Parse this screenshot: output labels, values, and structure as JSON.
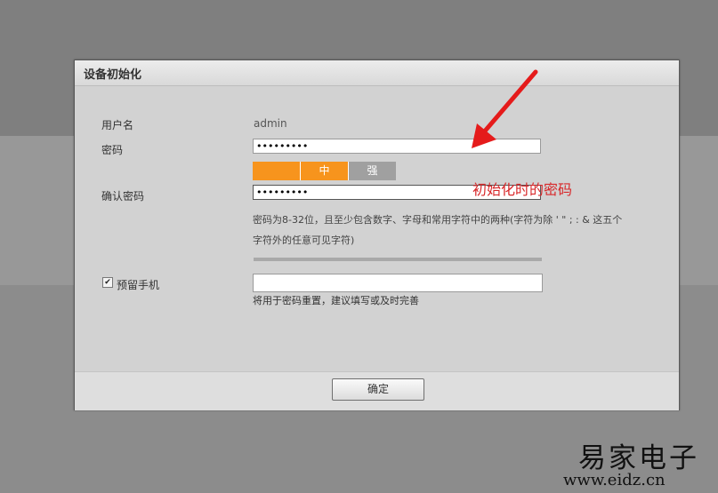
{
  "dialog": {
    "title": "设备初始化",
    "username_label": "用户名",
    "username_value": "admin",
    "password_label": "密码",
    "password_value": "•••••••••",
    "strength": {
      "medium_label": "中",
      "strong_label": "强",
      "active_color": "#f7941d",
      "inactive_color": "#a0a0a0"
    },
    "confirm_label": "确认密码",
    "confirm_value": "•••••••••",
    "hint_line1": "密码为8-32位，且至少包含数字、字母和常用字符中的两种(字符为除 ' \" ; : & 这五个",
    "hint_line2": "字符外的任意可见字符)",
    "phone_checkbox_label": "预留手机",
    "phone_checkbox_checked": true,
    "phone_value": "",
    "phone_hint": "将用于密码重置，建议填写或及时完善",
    "ok_label": "确定"
  },
  "annotation": {
    "text": "初始化时的密码",
    "color": "#e02020"
  },
  "watermark": {
    "main": "易家电子",
    "url": "www.eidz.cn"
  }
}
